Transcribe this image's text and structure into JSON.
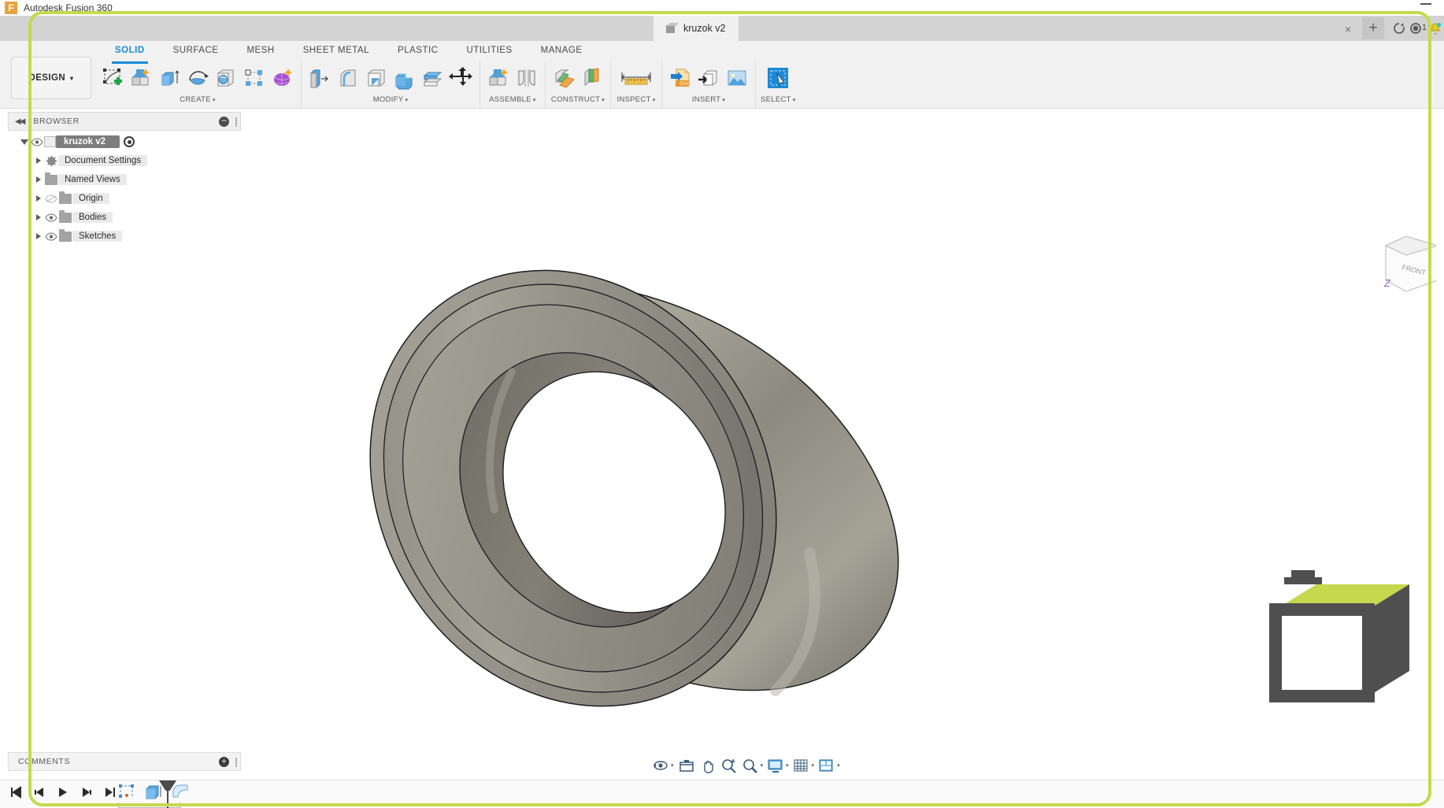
{
  "os": {
    "app_title": "Autodesk Fusion 360",
    "logo_letter": "F",
    "minimize": "minimize-window"
  },
  "tabbar": {
    "document_tab": "kruzok v2",
    "close_label": "×",
    "plus_label": "+",
    "icons": [
      {
        "name": "recent-history-icon"
      },
      {
        "name": "job-status-clock-icon",
        "badge": "1"
      },
      {
        "name": "notification-bell-icon"
      }
    ]
  },
  "ribbon": {
    "design_label": "DESIGN",
    "caret": "▾",
    "tabs": [
      {
        "label": "SOLID",
        "active": true
      },
      {
        "label": "SURFACE",
        "active": false
      },
      {
        "label": "MESH",
        "active": false
      },
      {
        "label": "SHEET METAL",
        "active": false
      },
      {
        "label": "PLASTIC",
        "active": false
      },
      {
        "label": "UTILITIES",
        "active": false
      },
      {
        "label": "MANAGE",
        "active": false
      }
    ],
    "groups": [
      {
        "name": "CREATE",
        "tools": [
          "new-sketch-icon",
          "create-form-icon",
          "extrude-icon",
          "revolve-icon",
          "sweep-icon",
          "pattern-icon",
          "create-mesh-icon"
        ]
      },
      {
        "name": "MODIFY",
        "tools": [
          "press-pull-icon",
          "fillet-icon",
          "shell-icon",
          "combine-icon",
          "offset-face-icon",
          "move-copy-icon"
        ]
      },
      {
        "name": "ASSEMBLE",
        "tools": [
          "new-component-icon",
          "joint-icon"
        ]
      },
      {
        "name": "CONSTRUCT",
        "tools": [
          "offset-plane-icon",
          "plane-at-angle-icon"
        ]
      },
      {
        "name": "INSPECT",
        "tools": [
          "measure-icon"
        ]
      },
      {
        "name": "INSERT",
        "tools": [
          "insert-svg-icon",
          "insert-derive-icon",
          "insert-image-icon"
        ]
      },
      {
        "name": "SELECT",
        "tools": [
          "select-window-icon"
        ]
      }
    ]
  },
  "browser": {
    "panel_title": "BROWSER",
    "collapse_icon": "collapse-panel-icon",
    "minimize_icon": "minimize-panel-icon",
    "tree": [
      {
        "label": "kruzok v2",
        "root": true,
        "expanded": true,
        "eye": "visible",
        "icon": "component-cube-icon"
      },
      {
        "label": "Document Settings",
        "root": false,
        "expanded": false,
        "eye": "none",
        "icon": "gear-icon"
      },
      {
        "label": "Named Views",
        "root": false,
        "expanded": false,
        "eye": "none",
        "icon": "folder-icon"
      },
      {
        "label": "Origin",
        "root": false,
        "expanded": false,
        "eye": "hidden",
        "icon": "folder-icon"
      },
      {
        "label": "Bodies",
        "root": false,
        "expanded": false,
        "eye": "visible",
        "icon": "folder-icon"
      },
      {
        "label": "Sketches",
        "root": false,
        "expanded": false,
        "eye": "visible",
        "icon": "folder-icon"
      }
    ]
  },
  "comments": {
    "title": "COMMENTS",
    "add_label": "+"
  },
  "navbar": {
    "items": [
      {
        "name": "orbit-icon",
        "caret": true
      },
      {
        "name": "look-at-icon",
        "caret": false
      },
      {
        "name": "pan-icon",
        "caret": false
      },
      {
        "name": "zoom-icon",
        "caret": false
      },
      {
        "name": "zoom-window-icon",
        "caret": true
      },
      {
        "name": "display-settings-icon",
        "caret": true
      },
      {
        "name": "grid-snaps-icon",
        "caret": true
      },
      {
        "name": "viewports-icon",
        "caret": true
      }
    ]
  },
  "timeline": {
    "controls": [
      "go-to-beginning-icon",
      "step-back-icon",
      "play-icon",
      "step-forward-icon",
      "go-to-end-icon"
    ],
    "features": [
      "sketch-feature-icon",
      "extrude-feature-icon",
      "fillet-feature-icon"
    ],
    "marker": "timeline-marker"
  },
  "viewport": {
    "model_name": "kruzok v2",
    "model_description": "shaded grey metallic ring / washer with chamfered edges",
    "viewcube_face": "FRONT",
    "axis_label": "Z",
    "colors": {
      "model_light": "#a9a69a",
      "model_mid": "#86847b",
      "model_dark": "#6f6d65",
      "model_edge": "#1d1d1d",
      "background": "#ffffff",
      "accent": "#1b8ad6",
      "focus_ring": "#c5d94e"
    }
  }
}
